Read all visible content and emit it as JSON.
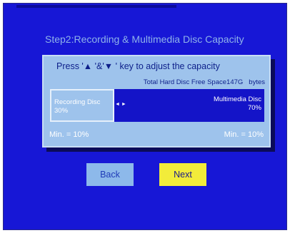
{
  "dialog": {
    "title": "Step2:Recording & Multimedia Disc Capacity",
    "instruction": "Press '▲ '&'▼ ' key to adjust the capacity",
    "free_space_label": "Total Hard Disc Free Space",
    "free_space_value": "147G",
    "free_space_unit": "bytes"
  },
  "capacity_bar": {
    "recording_label": "Recording Disc",
    "recording_percent": "30%",
    "multimedia_label": "Multimedia Disc",
    "multimedia_percent": "70%",
    "adjust_arrows": "◄ ►",
    "recording_fraction": 0.3
  },
  "limits": {
    "min_left": "Min. = 10%",
    "min_right": "Min. = 10%"
  },
  "buttons": {
    "back_label": "Back",
    "next_label": "Next"
  },
  "colors": {
    "background": "#1717d6",
    "panel": "#9ec3ec",
    "bar": "#1414c8",
    "next_highlight": "#f2ec3a",
    "back_button": "#8db9ea"
  }
}
